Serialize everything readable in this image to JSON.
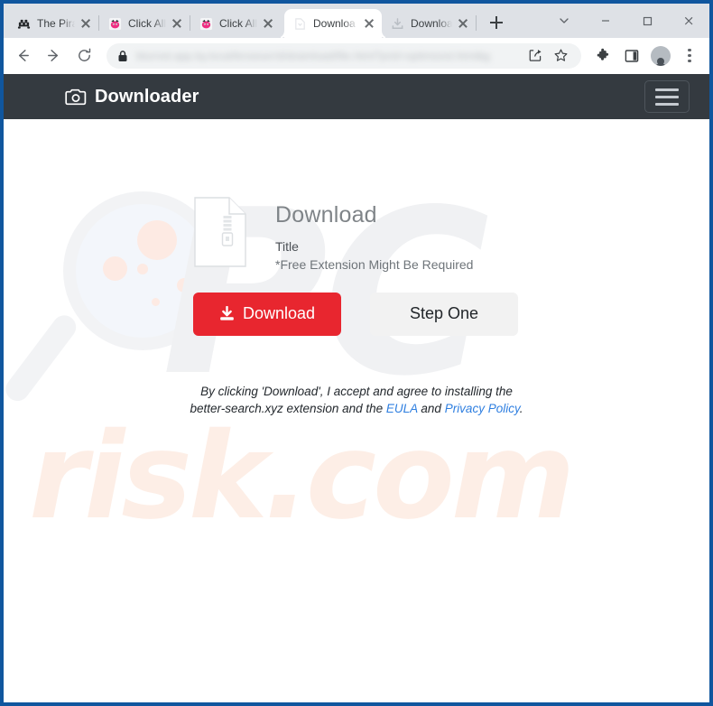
{
  "browser": {
    "tabs": [
      {
        "title": "The Pirat",
        "favicon": "pirate-ship-icon",
        "active": false,
        "close_label": "close-tab"
      },
      {
        "title": "Click Allo",
        "favicon": "pink-robot-icon",
        "active": false,
        "close_label": "close-tab"
      },
      {
        "title": "Click Allo",
        "favicon": "pink-robot-icon",
        "active": false,
        "close_label": "close-tab"
      },
      {
        "title": "Downloa",
        "favicon": "download-page-icon",
        "active": true,
        "close_label": "close-tab"
      },
      {
        "title": "Downloa",
        "favicon": "download-tray-icon",
        "active": false,
        "close_label": "close-tab"
      }
    ],
    "new_tab_label": "+",
    "window_controls": {
      "tab_search": "tab-search-chevron",
      "minimize": "minimize",
      "maximize": "maximize",
      "close": "close"
    },
    "toolbar": {
      "back": "back",
      "forward": "forward",
      "reload": "reload",
      "lock": "secure-lock",
      "url": "blurred.app.by.local/browser/d/download/file.html?prid=optimized.html&g",
      "share": "share",
      "bookmark": "bookmark-star",
      "extensions": "extensions-puzzle",
      "side_panel": "side-panel",
      "profile": "profile-avatar",
      "menu": "chrome-menu"
    }
  },
  "site": {
    "header": {
      "logo_icon": "camera-icon",
      "brand": "Downloader",
      "menu_button": "hamburger-menu"
    },
    "card": {
      "file_icon": "zip-file-icon",
      "heading": "Download",
      "title": "Title",
      "note": "*Free Extension Might Be Required"
    },
    "buttons": {
      "download": "Download",
      "download_icon": "download-arrow-icon",
      "step_one": "Step One"
    },
    "disclaimer": {
      "part1": "By clicking 'Download', I accept and agree to installing the better-search.xyz extension and the ",
      "eula": "EULA",
      "part2": " and ",
      "privacy": "Privacy Policy",
      "part3": "."
    },
    "watermark": {
      "main": "PC",
      "sub": "risk.com",
      "glass_icon": "magnifying-glass-icon"
    }
  },
  "colors": {
    "header_bg": "#343a40",
    "download_red": "#e8262f",
    "step_gray": "#f2f2f2",
    "link_blue": "#2f7fe0",
    "frame_blue": "#10569e",
    "watermark_gray": "#f0f1f3",
    "watermark_peach": "#fdeee6"
  }
}
